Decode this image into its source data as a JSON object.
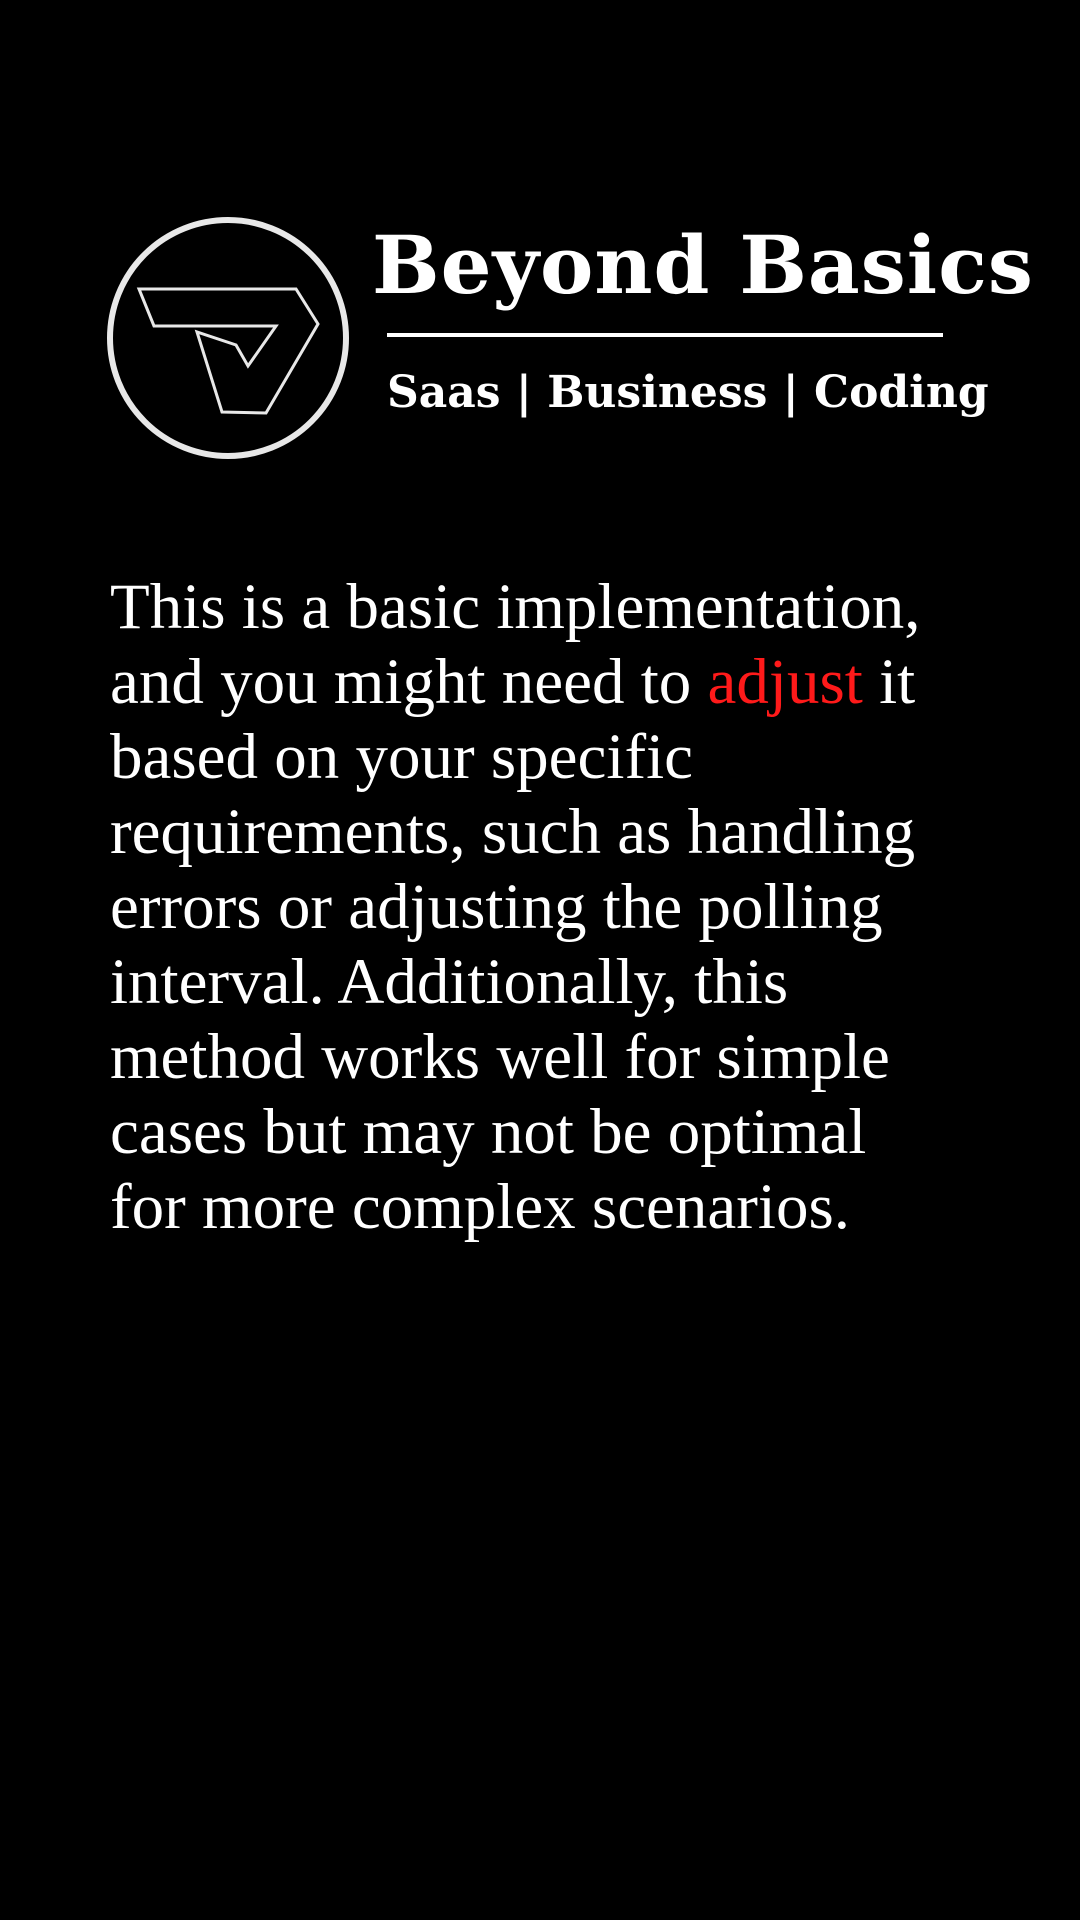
{
  "brand": {
    "title": "Beyond Basics",
    "tagline": "Saas | Business | Coding",
    "logo_icon": "stylized-v-logo-icon"
  },
  "content": {
    "line1": "This is a basic implementation,",
    "line2_before": "and you might need to ",
    "line2_highlight": "adjust",
    "line2_after": " it",
    "line3": "based on your specific",
    "line4": "requirements, such as handling",
    "line5": "errors or adjusting the polling",
    "line6": "interval. Additionally, this",
    "line7": "method works well for simple",
    "line8": "cases but may not be optimal",
    "line9": "for more complex scenarios."
  },
  "colors": {
    "background": "#000000",
    "text": "#ffffff",
    "highlight": "#ff1a1a"
  }
}
